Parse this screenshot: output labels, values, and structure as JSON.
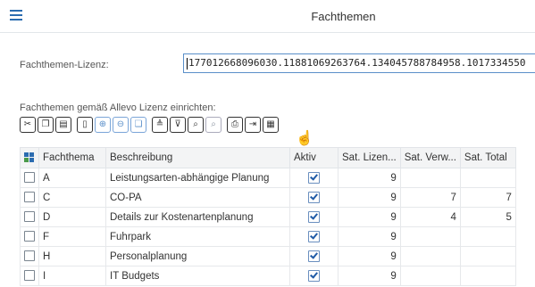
{
  "header": {
    "title": "Fachthemen"
  },
  "license": {
    "label": "Fachthemen-Lizenz:",
    "value": "177012668096030.11881069263764.134045788784958.1017334550"
  },
  "section": {
    "label": "Fachthemen gemäß Allevo Lizenz einrichten:"
  },
  "toolbar": {
    "icons": [
      "cut-icon",
      "copy-icon",
      "paste-icon",
      "new-icon",
      "insert-row-icon",
      "delete-row-icon",
      "copy-row-icon",
      "sort-asc-icon",
      "filter-icon",
      "find-icon",
      "find-next-icon",
      "print-icon",
      "export-icon",
      "layout-icon"
    ]
  },
  "table": {
    "columns": [
      "Fachthema",
      "Beschreibung",
      "Aktiv",
      "Sat. Lizen...",
      "Sat. Verw...",
      "Sat. Total"
    ],
    "rows": [
      {
        "fachthema": "A",
        "beschreibung": "Leistungsarten-abhängige Planung",
        "aktiv": true,
        "lizen": "9",
        "verw": "",
        "total": ""
      },
      {
        "fachthema": "C",
        "beschreibung": "CO-PA",
        "aktiv": true,
        "lizen": "9",
        "verw": "7",
        "total": "7"
      },
      {
        "fachthema": "D",
        "beschreibung": "Details zur Kostenartenplanung",
        "aktiv": true,
        "lizen": "9",
        "verw": "4",
        "total": "5"
      },
      {
        "fachthema": "F",
        "beschreibung": "Fuhrpark",
        "aktiv": true,
        "lizen": "9",
        "verw": "",
        "total": ""
      },
      {
        "fachthema": "H",
        "beschreibung": "Personalplanung",
        "aktiv": true,
        "lizen": "9",
        "verw": "",
        "total": ""
      },
      {
        "fachthema": "I",
        "beschreibung": "IT Budgets",
        "aktiv": true,
        "lizen": "9",
        "verw": "",
        "total": ""
      }
    ]
  }
}
